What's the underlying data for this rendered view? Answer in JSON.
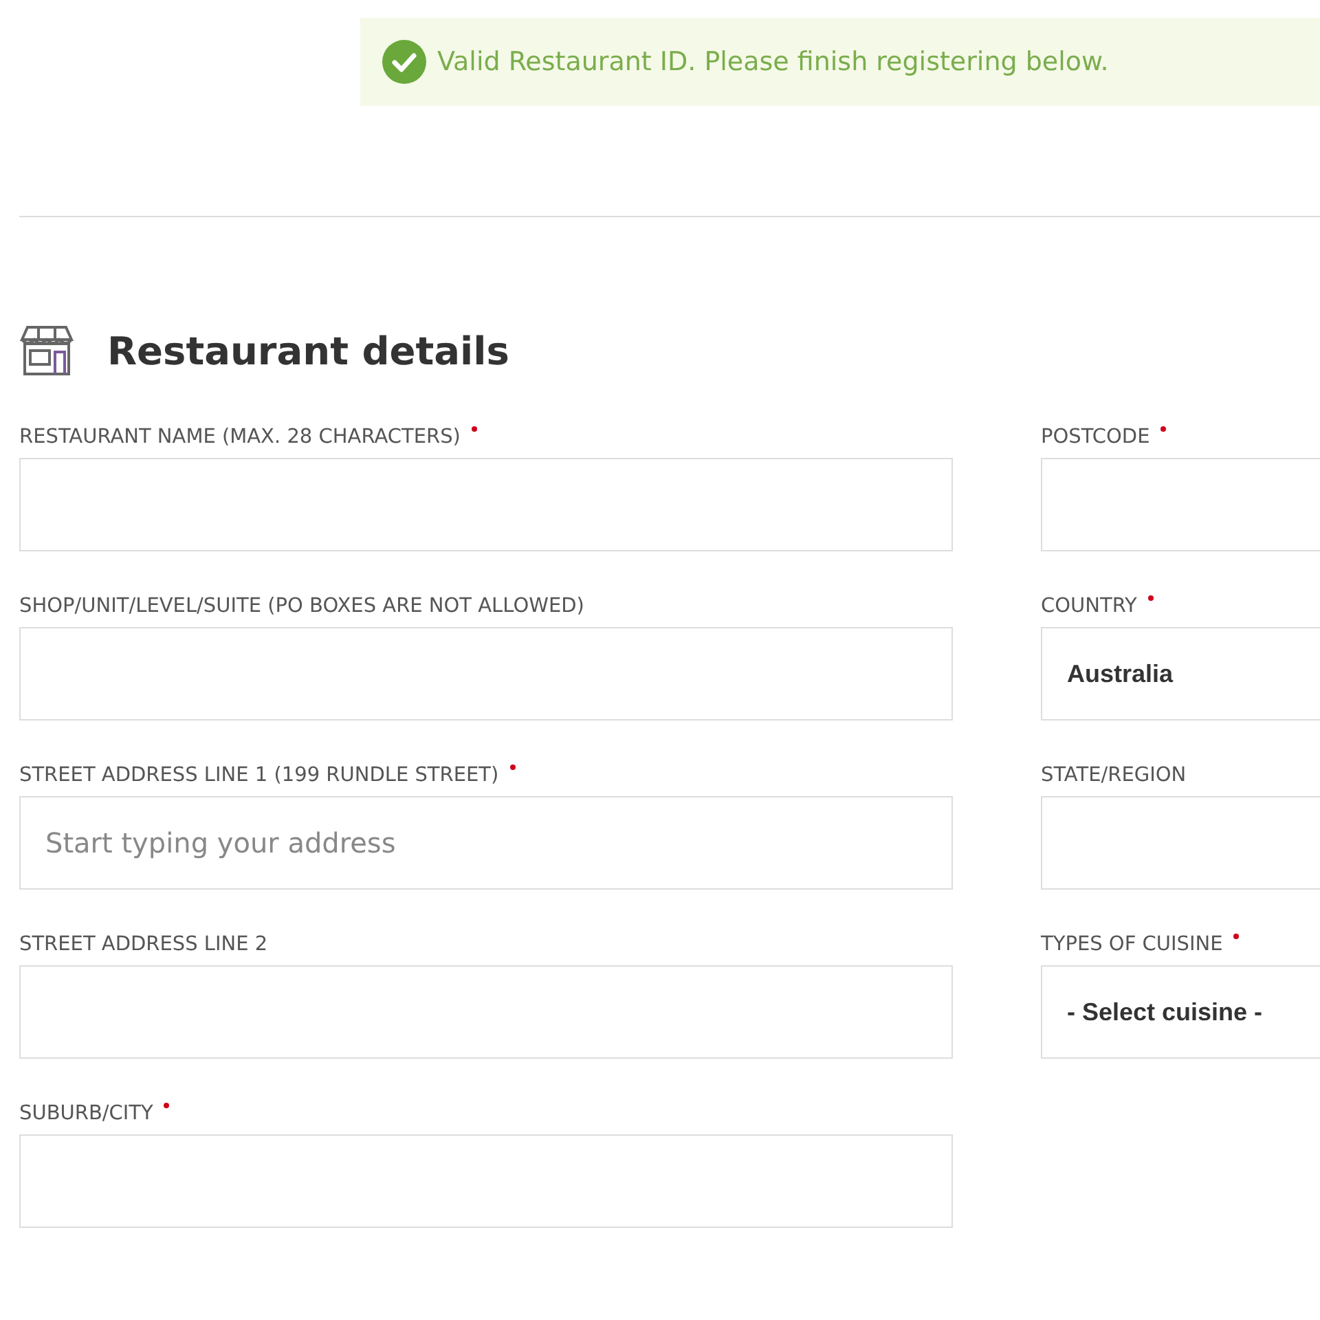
{
  "banner": {
    "message": "Valid Restaurant ID. Please finish registering below."
  },
  "section": {
    "title": "Restaurant details"
  },
  "left_fields": [
    {
      "label": "RESTAURANT NAME (MAX. 28 CHARACTERS)",
      "required": true,
      "kind": "input"
    },
    {
      "label": "SHOP/UNIT/LEVEL/SUITE (PO BOXES ARE NOT ALLOWED)",
      "required": false,
      "kind": "input"
    },
    {
      "label": "STREET ADDRESS LINE 1 (199 RUNDLE STREET)",
      "required": true,
      "kind": "input",
      "placeholder": "Start typing your address"
    },
    {
      "label": "STREET ADDRESS LINE 2",
      "required": false,
      "kind": "input"
    },
    {
      "label": "SUBURB/CITY",
      "required": true,
      "kind": "input"
    }
  ],
  "right_fields": [
    {
      "label": "POSTCODE",
      "required": true,
      "kind": "input"
    },
    {
      "label": "COUNTRY",
      "required": true,
      "kind": "select",
      "value": "Australia"
    },
    {
      "label": "STATE/REGION",
      "required": false,
      "kind": "input"
    },
    {
      "label": "TYPES OF CUISINE",
      "required": true,
      "kind": "select",
      "value": "- Select cuisine -"
    }
  ]
}
